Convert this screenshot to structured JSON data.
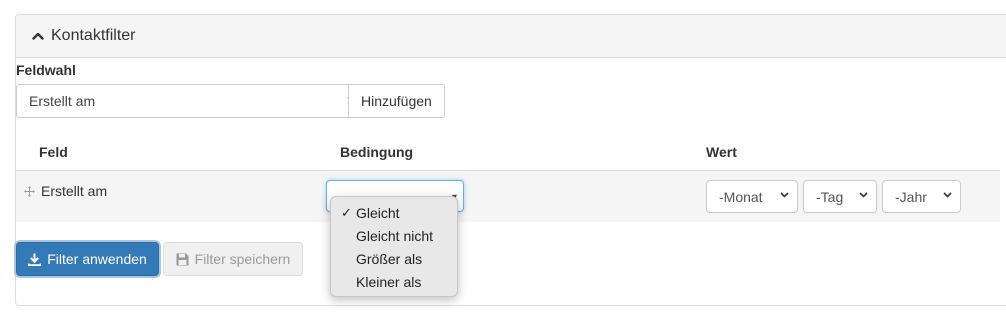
{
  "panel": {
    "title": "Kontaktfilter"
  },
  "field_selection": {
    "label": "Feldwahl",
    "selected": "Erstellt am",
    "add_button": "Hinzufügen"
  },
  "table": {
    "headers": [
      "Feld",
      "Bedingung",
      "Wert"
    ],
    "rows": [
      {
        "field": "Erstellt am",
        "condition_options": [
          "Gleicht",
          "Gleicht nicht",
          "Größer als",
          "Kleiner als"
        ],
        "condition_selected": "Gleicht",
        "value_selects": [
          "-Monat",
          "-Tag",
          "-Jahr"
        ]
      }
    ]
  },
  "actions": {
    "apply": "Filter anwenden",
    "save": "Filter speichern"
  },
  "colors": {
    "primary": "#337ab7",
    "panel_heading_bg": "#f5f5f5",
    "row_bg": "#f5f5f5",
    "disabled_text": "#999999"
  },
  "icons": {
    "panel_toggle": "chevron-up-icon",
    "row_drag": "move-icon",
    "apply": "download-icon",
    "save": "floppy-disk-icon",
    "checkmark": "check-icon"
  }
}
